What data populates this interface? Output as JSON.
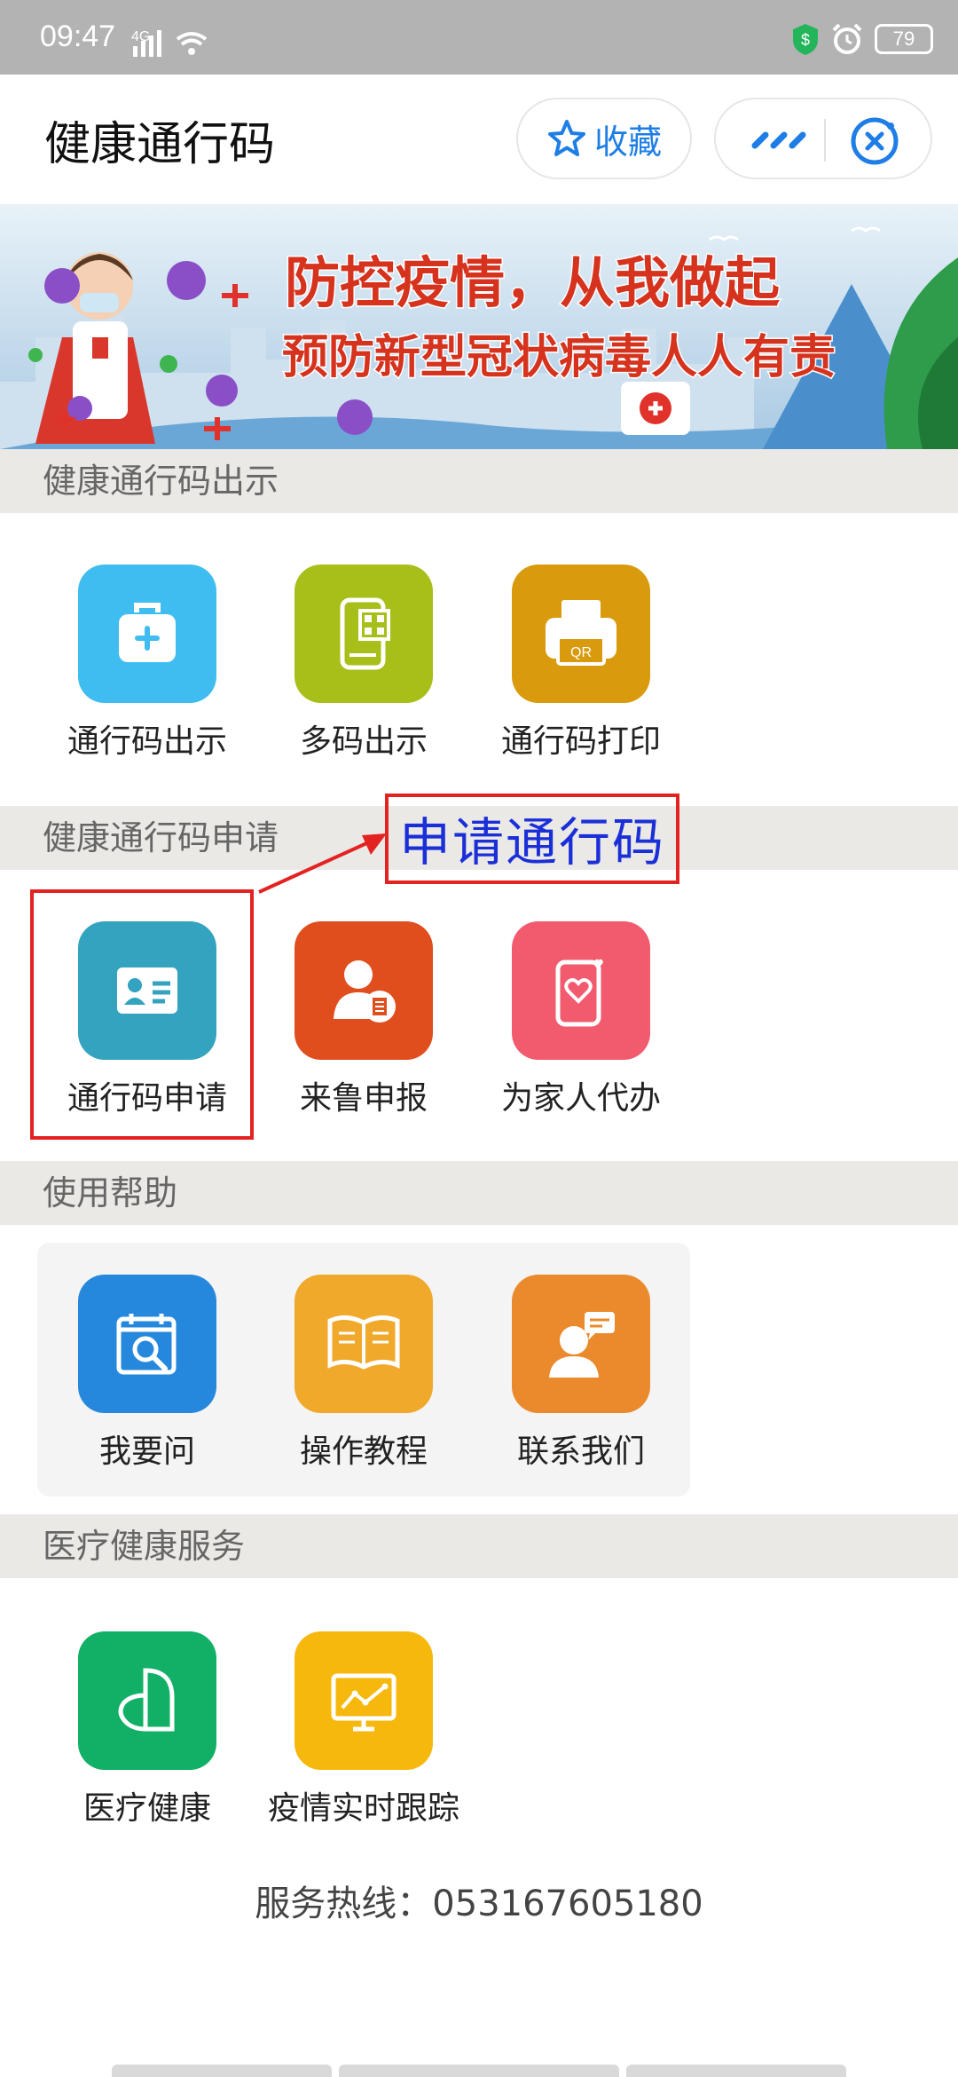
{
  "status_bar": {
    "time": "09:47",
    "network": "4G",
    "battery": "79"
  },
  "header": {
    "title": "健康通行码",
    "favorite_label": "收藏"
  },
  "banner": {
    "line1": "防控疫情，从我做起",
    "line2": "预防新型冠状病毒人人有责"
  },
  "sections": [
    {
      "title": "健康通行码出示",
      "items": [
        {
          "label": "通行码出示",
          "icon": "medical-kit-icon",
          "color": "#3fbdf0"
        },
        {
          "label": "多码出示",
          "icon": "phone-qr-icon",
          "color": "#a8bf1a"
        },
        {
          "label": "通行码打印",
          "icon": "printer-icon",
          "color": "#d99a0e"
        }
      ]
    },
    {
      "title": "健康通行码申请",
      "items": [
        {
          "label": "通行码申请",
          "icon": "id-card-icon",
          "color": "#33a3bf"
        },
        {
          "label": "来鲁申报",
          "icon": "user-report-icon",
          "color": "#e04e1e"
        },
        {
          "label": "为家人代办",
          "icon": "phone-heart-icon",
          "color": "#f25a6e"
        }
      ]
    },
    {
      "title": "使用帮助",
      "items": [
        {
          "label": "我要问",
          "icon": "calendar-search-icon",
          "color": "#2688dc"
        },
        {
          "label": "操作教程",
          "icon": "book-icon",
          "color": "#f0a92a"
        },
        {
          "label": "联系我们",
          "icon": "contact-icon",
          "color": "#ea8a2c"
        }
      ]
    },
    {
      "title": "医疗健康服务",
      "items": [
        {
          "label": "医疗健康",
          "icon": "health-shape-icon",
          "color": "#12b066"
        },
        {
          "label": "疫情实时跟踪",
          "icon": "monitor-chart-icon",
          "color": "#f7b80e"
        }
      ]
    }
  ],
  "hotline": "服务热线：053167605180",
  "annotation": {
    "text": "申请通行码"
  }
}
